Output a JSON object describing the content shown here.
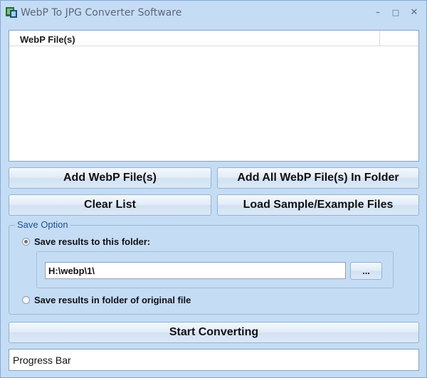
{
  "window": {
    "title": "WebP To JPG Converter Software",
    "minimize": "–",
    "maximize": "□",
    "close": "✕"
  },
  "file_list": {
    "column_header": "WebP File(s)"
  },
  "buttons": {
    "add_files": "Add WebP File(s)",
    "add_folder": "Add All WebP File(s) In Folder",
    "clear_list": "Clear List",
    "load_sample": "Load Sample/Example Files",
    "start": "Start Converting",
    "browse": "..."
  },
  "save_option": {
    "title": "Save Option",
    "option_folder": "Save results to this folder:",
    "option_original": "Save results in folder of original file",
    "selected": "option_folder",
    "folder_path": "H:\\webp\\1\\"
  },
  "progress": {
    "label": "Progress Bar"
  }
}
